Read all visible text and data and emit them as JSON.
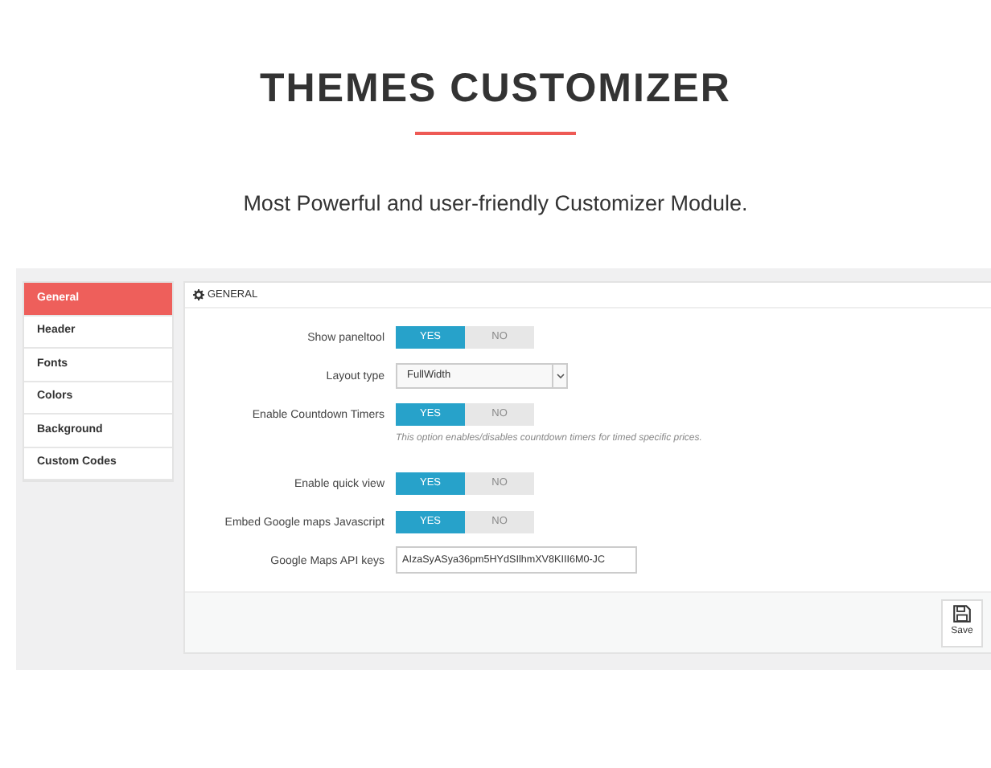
{
  "heading": {
    "title": "THEMES CUSTOMIZER",
    "subtitle": "Most Powerful and user-friendly Customizer Module."
  },
  "sidebar": {
    "items": [
      {
        "label": "General",
        "selected": true
      },
      {
        "label": "Header",
        "selected": false
      },
      {
        "label": "Fonts",
        "selected": false
      },
      {
        "label": "Colors",
        "selected": false
      },
      {
        "label": "Background",
        "selected": false
      },
      {
        "label": "Custom Codes",
        "selected": false
      }
    ]
  },
  "panel": {
    "title": "GENERAL",
    "settings": [
      {
        "kind": "toggle",
        "label": "Show paneltool",
        "options": [
          {
            "label": "YES",
            "selected": true
          },
          {
            "label": "NO",
            "selected": false
          }
        ]
      },
      {
        "kind": "select",
        "label": "Layout type",
        "value": "FullWidth"
      },
      {
        "kind": "toggle",
        "label": "Enable Countdown Timers",
        "options": [
          {
            "label": "YES",
            "selected": true
          },
          {
            "label": "NO",
            "selected": false
          }
        ],
        "hint": "This option enables/disables countdown timers for timed specific prices."
      },
      {
        "kind": "toggle",
        "label": "Enable quick view",
        "options": [
          {
            "label": "YES",
            "selected": true
          },
          {
            "label": "NO",
            "selected": false
          }
        ]
      },
      {
        "kind": "toggle",
        "label": "Embed Google maps Javascript",
        "options": [
          {
            "label": "YES",
            "selected": true
          },
          {
            "label": "NO",
            "selected": false
          }
        ]
      },
      {
        "kind": "text",
        "label": "Google Maps API keys",
        "value": "AIzaSyASya36pm5HYdSIlhmXV8KIII6M0-JC"
      }
    ],
    "save_button": "Save"
  }
}
